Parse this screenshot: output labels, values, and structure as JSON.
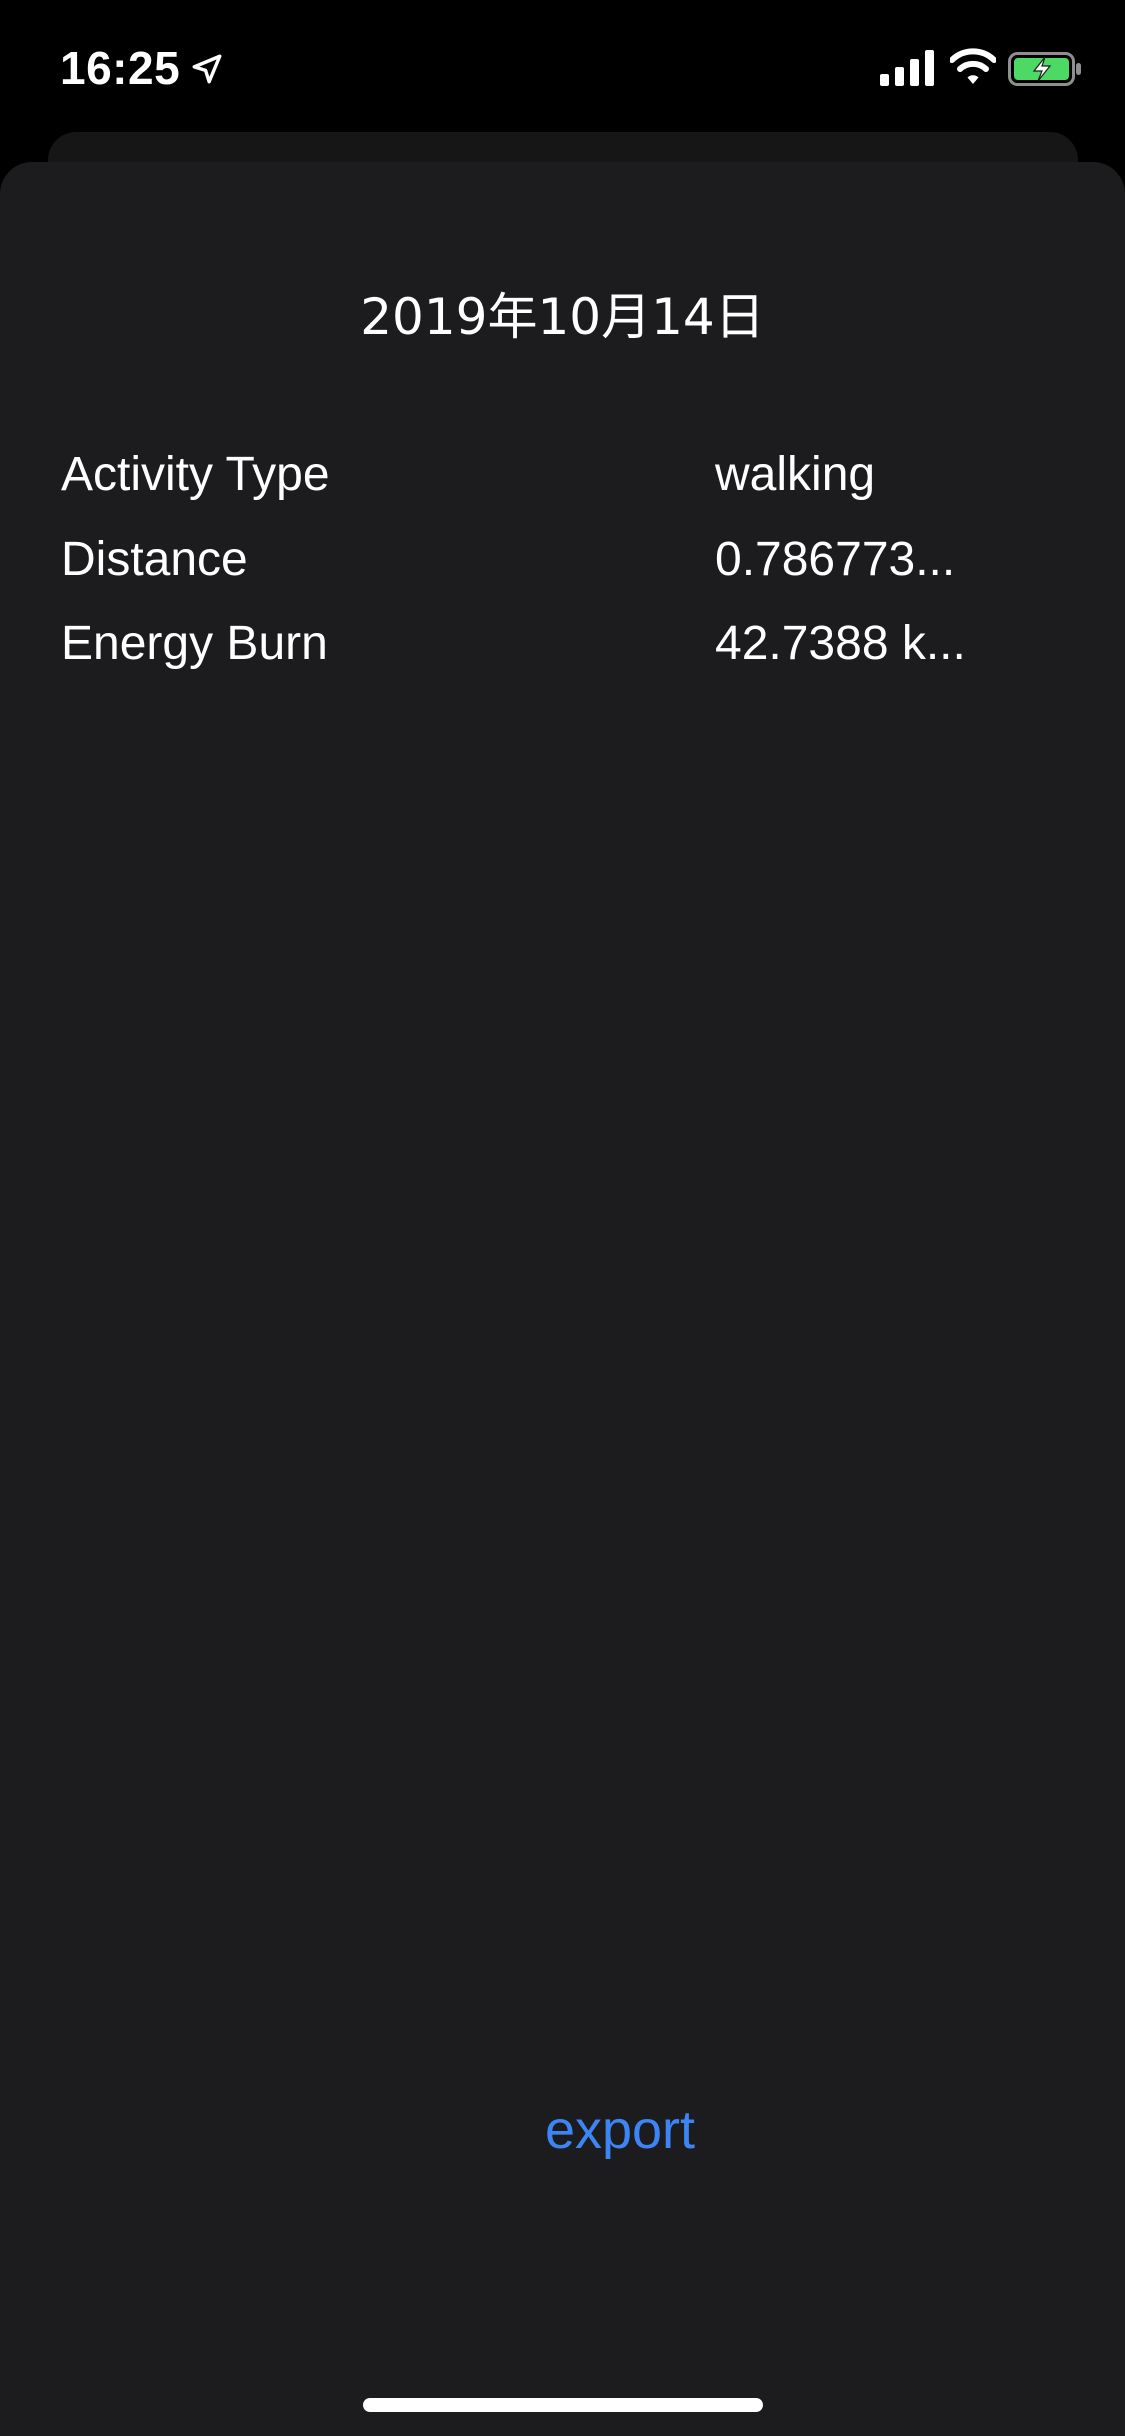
{
  "status_bar": {
    "time": "16:25",
    "icons": [
      "location-arrow-icon",
      "cellular-signal-icon",
      "wifi-icon",
      "battery-charging-icon"
    ],
    "battery_color": "#4cd964"
  },
  "detail": {
    "date": "2019年10月14日",
    "rows": [
      {
        "label": "Activity Type",
        "value": "walking"
      },
      {
        "label": "Distance",
        "value": "0.786773..."
      },
      {
        "label": "Energy Burn",
        "value": "42.7388 k..."
      }
    ]
  },
  "actions": {
    "export_label": "export",
    "accent_color": "#3d85f5"
  },
  "theme": {
    "background": "#000000",
    "sheet": "#1c1c1e",
    "text": "#ffffff"
  }
}
